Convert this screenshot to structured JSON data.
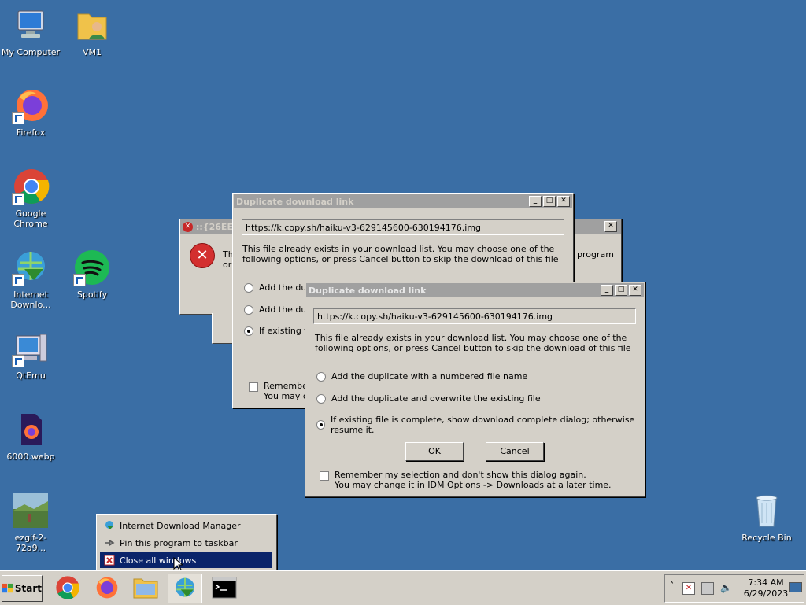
{
  "desktop": {
    "icons": [
      {
        "label": "My Computer",
        "icon": "computer-icon"
      },
      {
        "label": "VM1",
        "icon": "user-folder-icon"
      },
      {
        "label": "Firefox",
        "icon": "firefox-icon"
      },
      {
        "label": "Google Chrome",
        "icon": "chrome-icon"
      },
      {
        "label": "Internet Downlo...",
        "icon": "idm-icon"
      },
      {
        "label": "Spotify",
        "icon": "spotify-icon"
      },
      {
        "label": "QtEmu",
        "icon": "qtemu-icon"
      },
      {
        "label": "6000.webp",
        "icon": "webp-file-icon"
      },
      {
        "label": "ezgif-2-72a9...",
        "icon": "image-thumbnail-icon"
      },
      {
        "label": "Recycle Bin",
        "icon": "recycle-bin-icon"
      }
    ]
  },
  "error_window": {
    "title": "::{26EE0",
    "text_line1": "Th",
    "text_line2": "or,",
    "text_right": "program"
  },
  "dialog_back": {
    "title": "Duplicate download link",
    "url": "https://k.copy.sh/haiku-v3-629145600-630194176.img",
    "message": "This file already exists in your download list. You may choose one of the following options, or press Cancel button to skip the download of this file",
    "option1": "Add the dup",
    "option2": "Add the dup",
    "option3": "If existing fil",
    "remember1": "Remember",
    "remember2": "You may ch"
  },
  "dialog_front": {
    "title": "Duplicate download link",
    "url": "https://k.copy.sh/haiku-v3-629145600-630194176.img",
    "message": "This file already exists in your download list. You may choose one of the following options, or press Cancel button to skip the download of this file",
    "options": [
      "Add the duplicate with a numbered file name",
      "Add the duplicate and overwrite the existing file",
      "If existing file is complete, show download complete dialog; otherwise resume it."
    ],
    "selected_option": 2,
    "ok_label": "OK",
    "cancel_label": "Cancel",
    "remember_line1": "Remember my selection and don't show this dialog again.",
    "remember_line2": "You may change it in IDM Options -> Downloads at a later time."
  },
  "context_menu": {
    "items": [
      {
        "label": "Internet Download Manager",
        "icon": "idm-icon"
      },
      {
        "label": "Pin this program to taskbar",
        "icon": "pin-icon"
      },
      {
        "label": "Close all windows",
        "icon": "close-icon"
      }
    ]
  },
  "taskbar": {
    "start_label": "Start",
    "apps": [
      "chrome-icon",
      "firefox-icon",
      "explorer-icon",
      "idm-icon",
      "cmd-icon"
    ],
    "tray_icons": [
      "chevron-up-icon",
      "security-alert-icon",
      "network-icon",
      "volume-muted-icon",
      "desktop-icon"
    ],
    "time": "7:34 AM",
    "date": "6/29/2023"
  }
}
